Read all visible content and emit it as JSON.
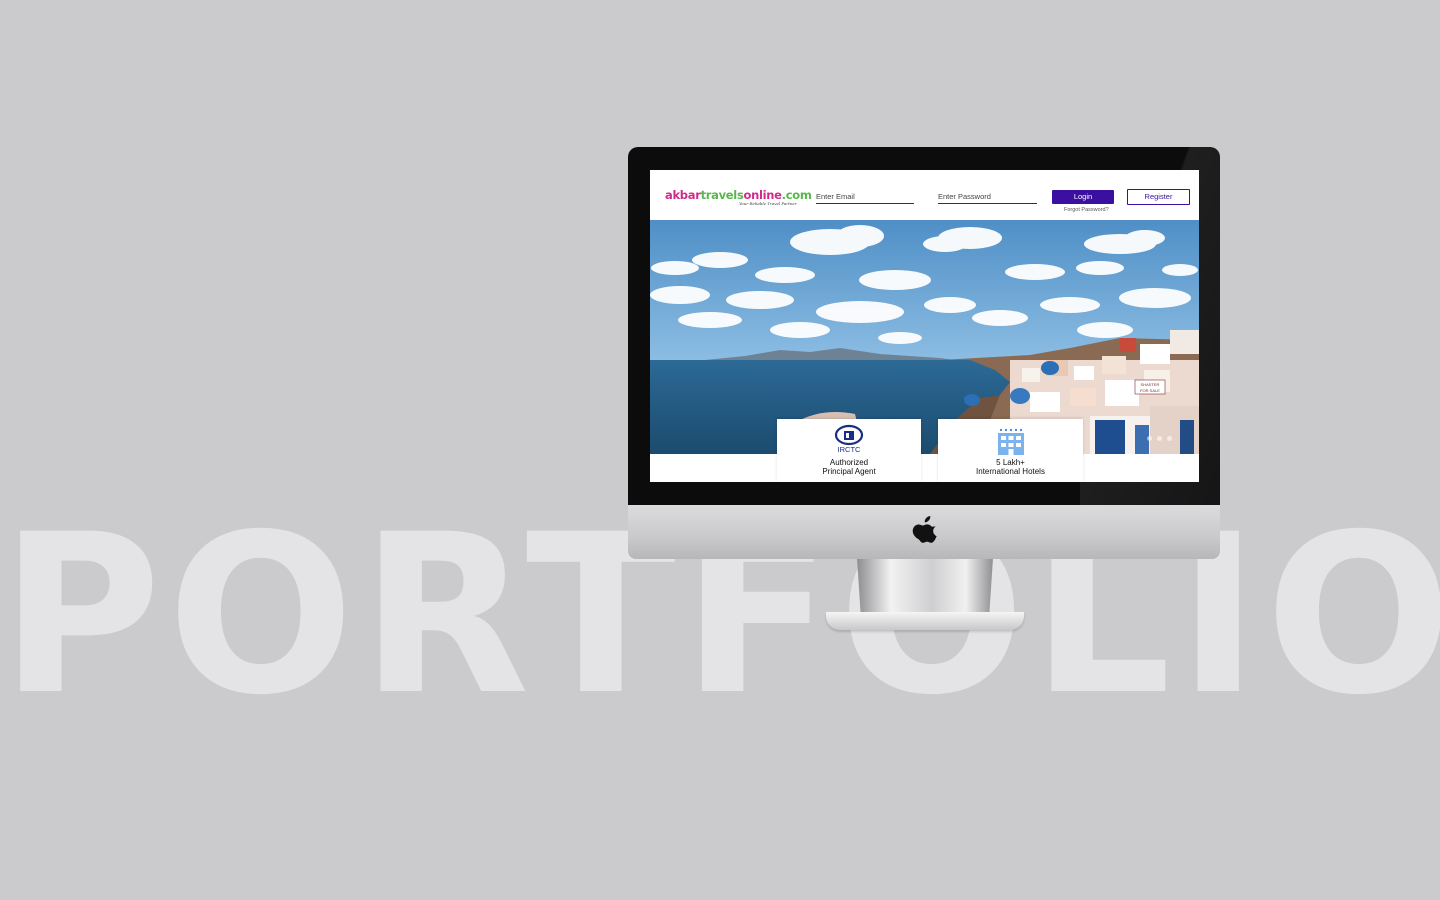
{
  "background_text": "PORTFOLIO",
  "device": {
    "logo_icon": "apple-logo-icon"
  },
  "site": {
    "logo": {
      "part1": "akbar",
      "part2": "travels",
      "part3": "online",
      "part4": ".com",
      "tagline": "Your Reliable Travel Partner"
    },
    "email_placeholder": "Enter Email",
    "password_placeholder": "Enter Password",
    "login_label": "Login",
    "register_label": "Register",
    "forgot_label": "Forgot Password?",
    "cards": [
      {
        "icon": "irctc-logo-icon",
        "icon_text": "IRCTC",
        "line1": "Authorized",
        "line2": "Principal Agent"
      },
      {
        "icon": "hotel-building-icon",
        "line1": "5 Lakh+",
        "line2": "International Hotels"
      }
    ],
    "hero_signs": {
      "sign1": "SHASTER",
      "sign2": "FOR SALE"
    }
  },
  "colors": {
    "page_background": "#cbcacd",
    "watermark": "#e4e4e6",
    "brand_pink": "#d12a8a",
    "brand_green": "#57b84a",
    "primary_button": "#3b0fa0"
  }
}
